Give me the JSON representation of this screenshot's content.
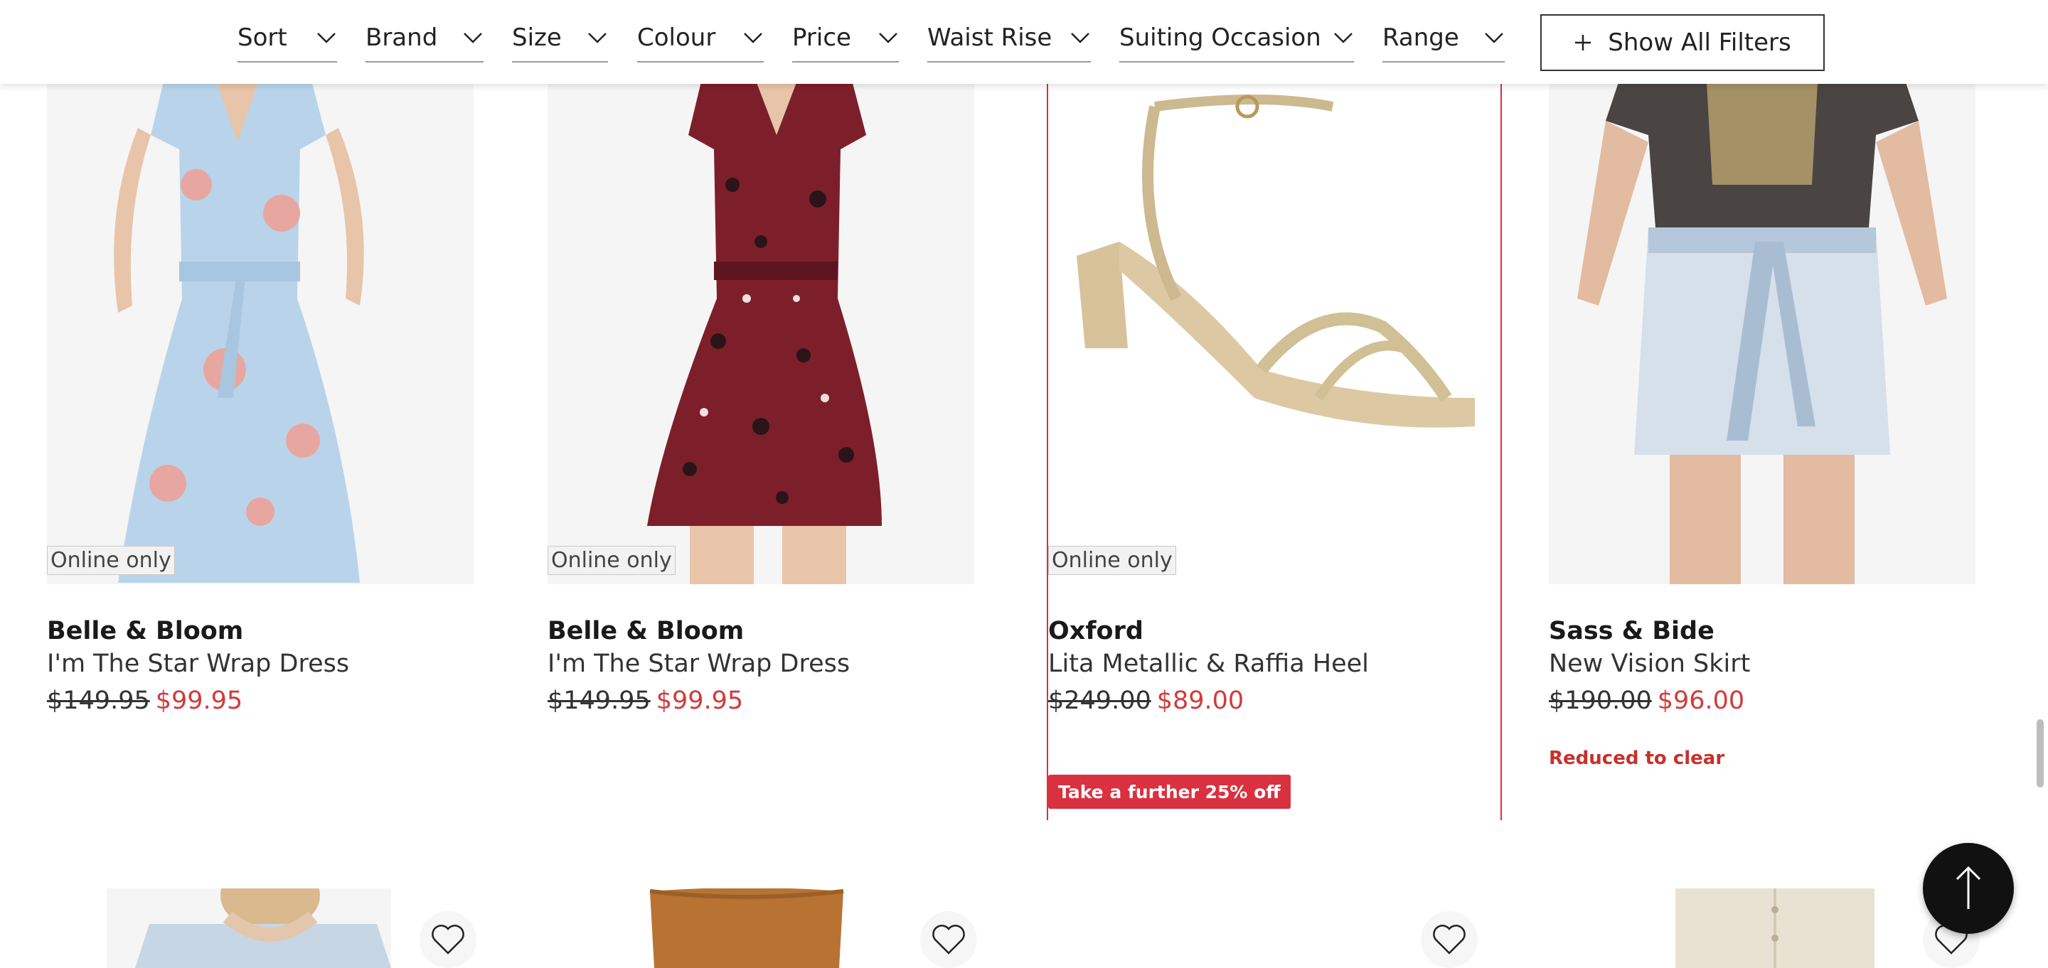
{
  "filters": [
    {
      "label": "Sort"
    },
    {
      "label": "Brand"
    },
    {
      "label": "Size"
    },
    {
      "label": "Colour"
    },
    {
      "label": "Price"
    },
    {
      "label": "Waist Rise"
    },
    {
      "label": "Suiting Occasion"
    },
    {
      "label": "Range"
    }
  ],
  "show_all_filters": "Show All Filters",
  "products": [
    {
      "badge": "Online only",
      "brand": "Belle & Bloom",
      "name": "I'm The Star Wrap Dress",
      "was_price": "$149.95",
      "now_price": "$99.95"
    },
    {
      "badge": "Online only",
      "brand": "Belle & Bloom",
      "name": "I'm The Star Wrap Dress",
      "was_price": "$149.95",
      "now_price": "$99.95"
    },
    {
      "badge": "Online only",
      "brand": "Oxford",
      "name": "Lita Metallic & Raffia Heel",
      "was_price": "$249.00",
      "now_price": "$89.00",
      "promo": "Take a further 25% off"
    },
    {
      "brand": "Sass & Bide",
      "name": "New Vision Skirt",
      "was_price": "$190.00",
      "now_price": "$96.00",
      "note": "Reduced to clear"
    }
  ],
  "colors": {
    "sale_price": "#d13b3b",
    "promo_bg": "#d9313f",
    "highlight_border": "#d9313f"
  },
  "icons": {
    "filter_chevron": "chevron-down-icon",
    "show_all": "plus-icon",
    "wishlist": "heart-icon",
    "back_to_top": "arrow-up-icon"
  }
}
